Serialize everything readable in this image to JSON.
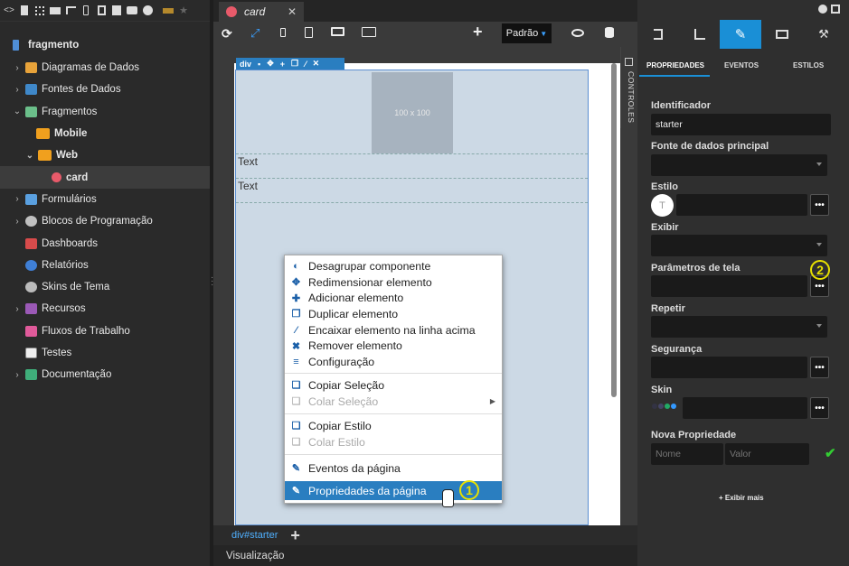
{
  "left_panel": {
    "project": "fragmento",
    "items": [
      {
        "label": "Diagramas de Dados",
        "icon": "diagram-icon"
      },
      {
        "label": "Fontes de Dados",
        "icon": "datasource-icon"
      },
      {
        "label": "Fragmentos",
        "icon": "fragment-icon"
      },
      {
        "label": "Mobile",
        "icon": "folder-icon"
      },
      {
        "label": "Web",
        "icon": "folder-icon"
      },
      {
        "label": "card",
        "icon": "card-icon"
      },
      {
        "label": "Formulários",
        "icon": "form-icon"
      },
      {
        "label": "Blocos de Programação",
        "icon": "blocks-icon"
      },
      {
        "label": "Dashboards",
        "icon": "dashboard-icon"
      },
      {
        "label": "Relatórios",
        "icon": "report-icon"
      },
      {
        "label": "Skins de Tema",
        "icon": "palette-icon"
      },
      {
        "label": "Recursos",
        "icon": "resources-icon"
      },
      {
        "label": "Fluxos de Trabalho",
        "icon": "workflow-icon"
      },
      {
        "label": "Testes",
        "icon": "tests-icon"
      },
      {
        "label": "Documentação",
        "icon": "docs-icon"
      }
    ]
  },
  "editor": {
    "tab": "card",
    "theme_select": "Padrão",
    "element_tag": "div",
    "placeholder_image": "100 x 100",
    "text1": "Text",
    "text2": "Text",
    "controls_label": "CONTROLES",
    "breadcrumb": "div#starter",
    "bottom_tab": "Visualização"
  },
  "context_menu": {
    "items": [
      {
        "label": "Desagrupar componente",
        "icon": "unlock-icon",
        "disabled": false
      },
      {
        "label": "Redimensionar elemento",
        "icon": "resize-icon",
        "disabled": false
      },
      {
        "label": "Adicionar elemento",
        "icon": "plus-icon",
        "disabled": false
      },
      {
        "label": "Duplicar elemento",
        "icon": "duplicate-icon",
        "disabled": false
      },
      {
        "label": "Encaixar elemento na linha acima",
        "icon": "wand-icon",
        "disabled": false
      },
      {
        "label": "Remover elemento",
        "icon": "close-icon",
        "disabled": false
      },
      {
        "label": "Configuração",
        "icon": "database-icon",
        "disabled": false
      },
      {
        "label": "Copiar Seleção",
        "icon": "copy-icon",
        "disabled": false
      },
      {
        "label": "Colar Seleção",
        "icon": "paste-icon",
        "disabled": true
      },
      {
        "label": "Copiar Estilo",
        "icon": "copy-icon",
        "disabled": false
      },
      {
        "label": "Colar Estilo",
        "icon": "paste-icon",
        "disabled": true
      },
      {
        "label": "Eventos da página",
        "icon": "edit-icon",
        "disabled": false
      },
      {
        "label": "Propriedades da página",
        "icon": "edit-icon",
        "disabled": false
      }
    ]
  },
  "annotations": [
    "1",
    "2"
  ],
  "right_panel": {
    "tabs": [
      "PROPRIEDADES",
      "EVENTOS",
      "ESTILOS"
    ],
    "fields": {
      "identificador_label": "Identificador",
      "identificador_value": "starter",
      "fonte_label": "Fonte de dados principal",
      "estilo_label": "Estilo",
      "estilo_avatar": "T",
      "exibir_label": "Exibir",
      "parametros_label": "Parâmetros de tela",
      "repetir_label": "Repetir",
      "seguranca_label": "Segurança",
      "skin_label": "Skin",
      "nova_label": "Nova Propriedade",
      "nome_placeholder": "Nome",
      "valor_placeholder": "Valor",
      "dots_label": "•••",
      "exibir_mais": "+ Exibir mais"
    }
  },
  "colors": {
    "accent": "#1a8fd6",
    "selected_menu": "#2a7ec0",
    "annotation": "#e8e000"
  }
}
